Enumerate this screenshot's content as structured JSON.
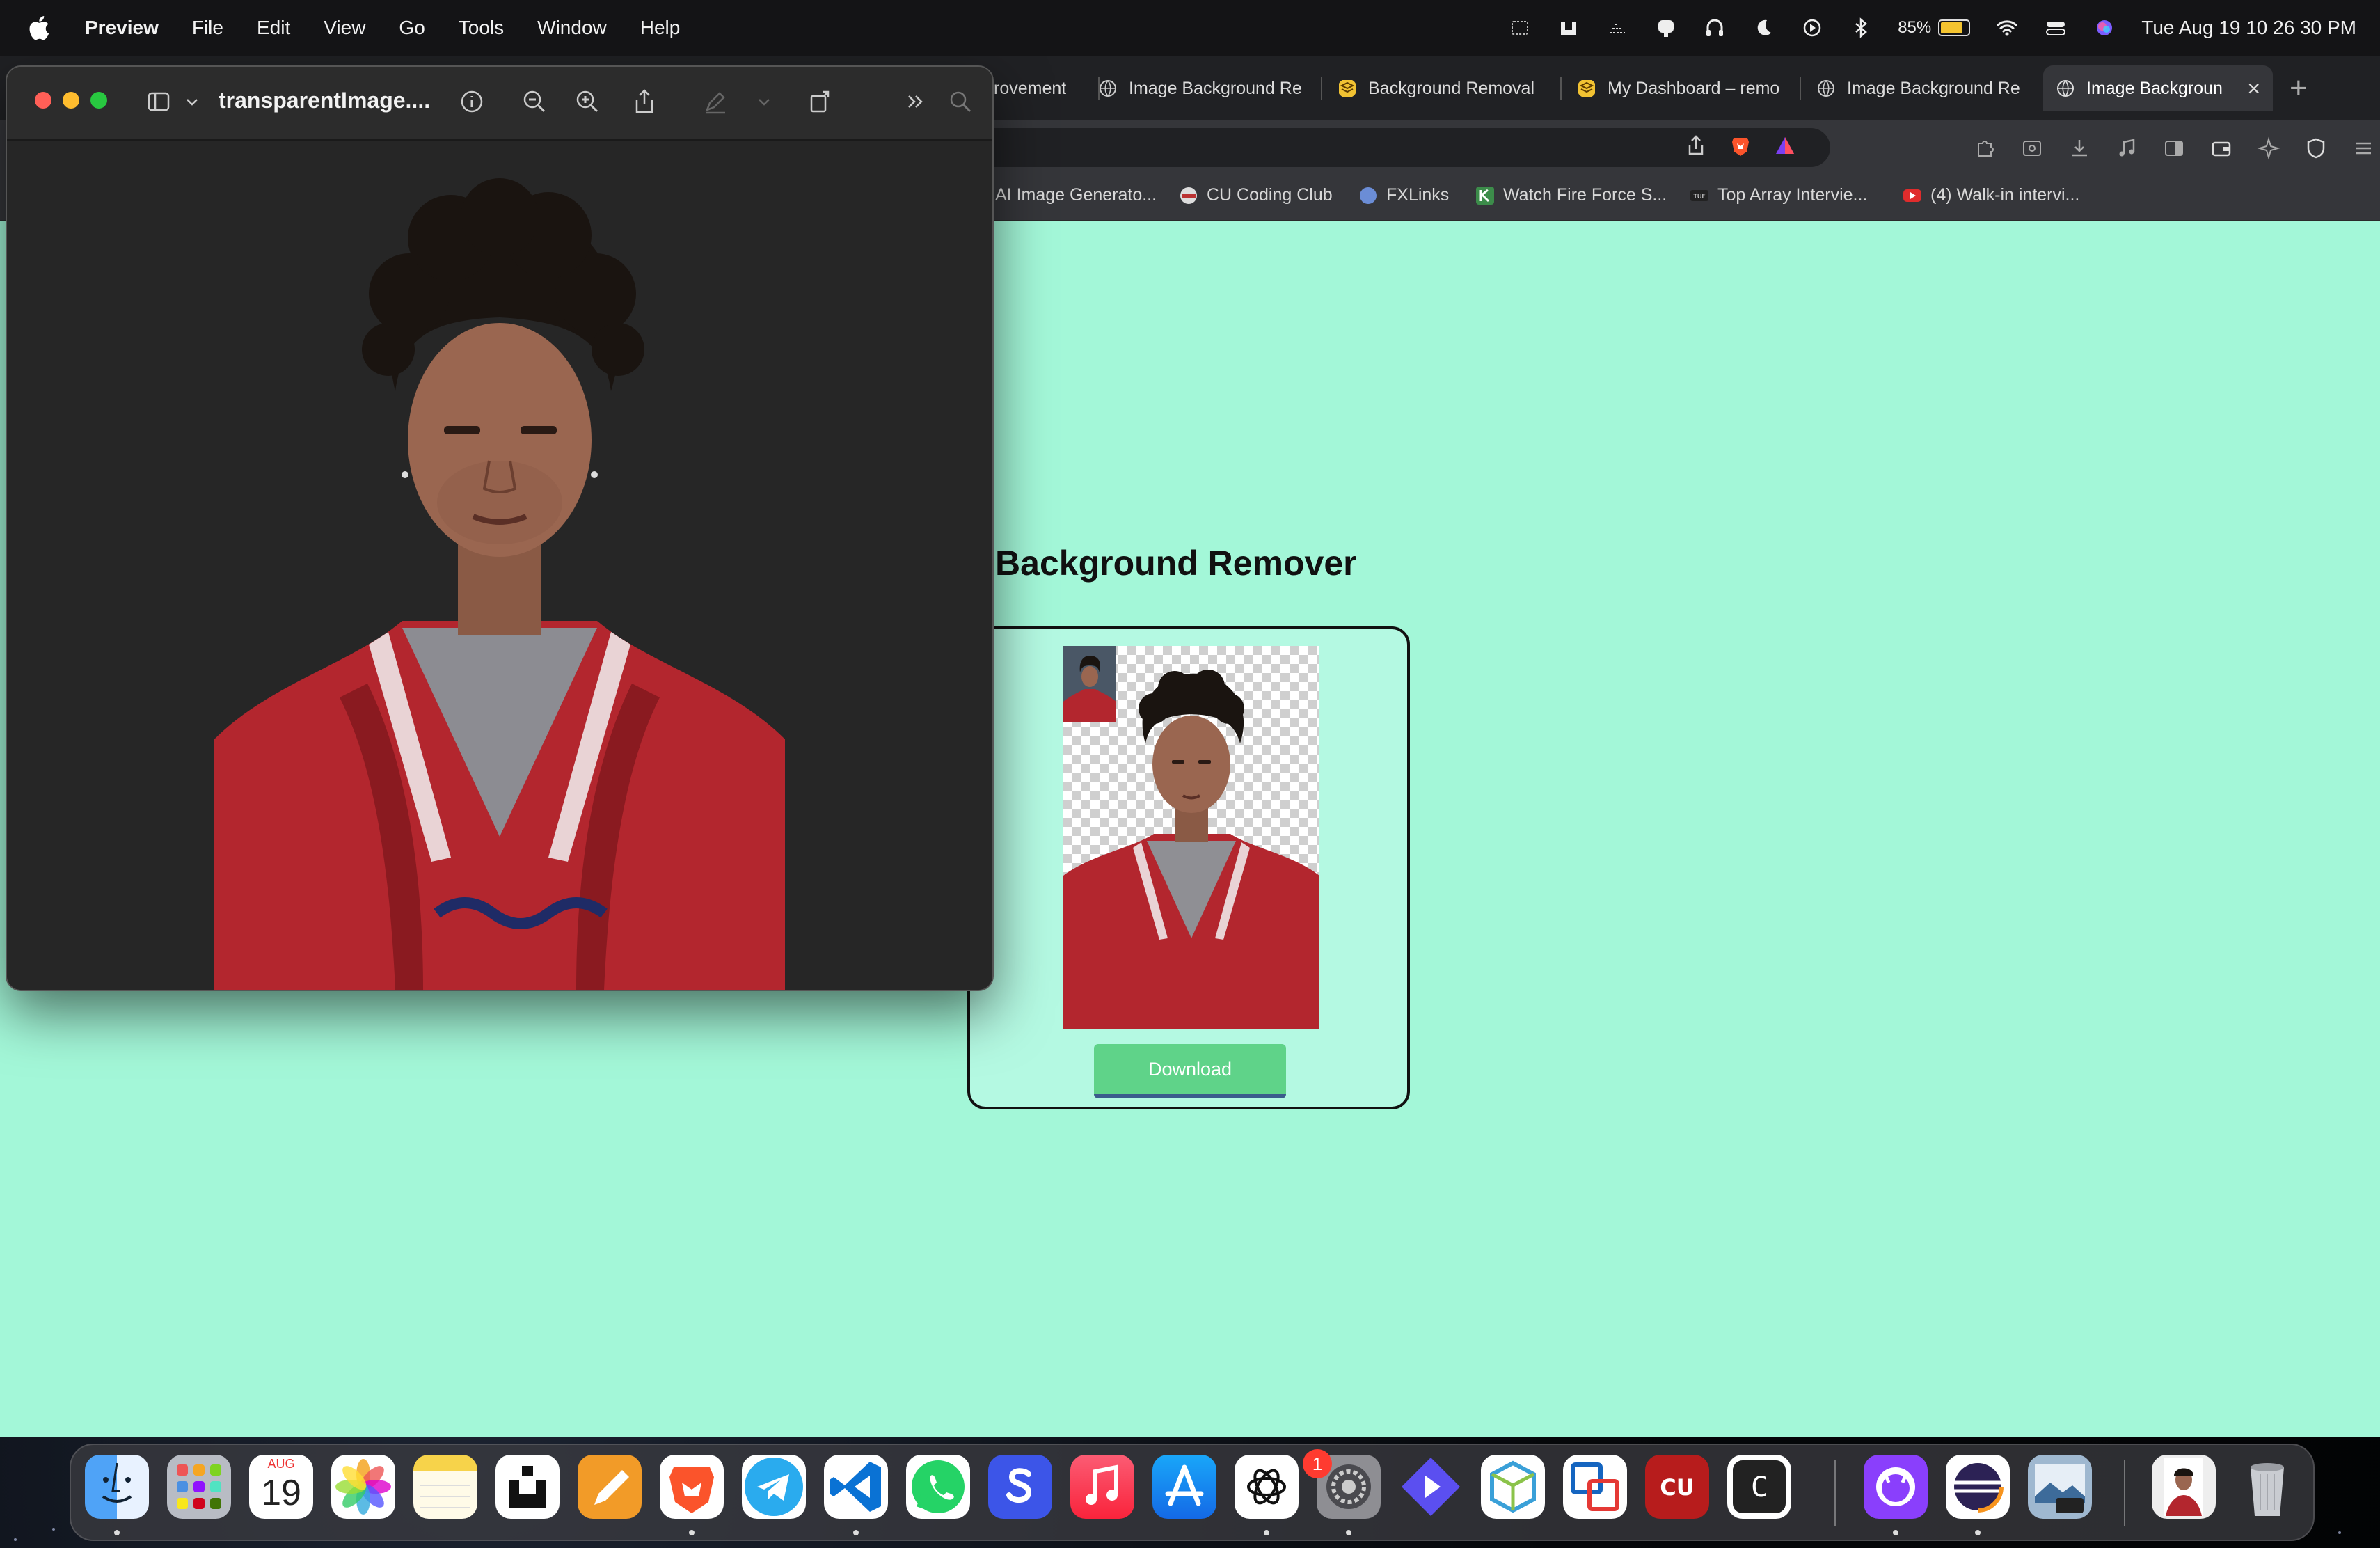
{
  "menubar": {
    "app_name": "Preview",
    "items": [
      "File",
      "Edit",
      "View",
      "Go",
      "Tools",
      "Window",
      "Help"
    ],
    "battery_percent": "85%",
    "battery_level": 0.85,
    "datetime": "Tue Aug 19  10 26 30 PM"
  },
  "browser": {
    "tabs": [
      {
        "label": "rovement",
        "icon": "page-icon"
      },
      {
        "label": "Image Background Re",
        "icon": "globe-icon"
      },
      {
        "label": "Background Removal",
        "icon": "stack-icon"
      },
      {
        "label": "My Dashboard – remo",
        "icon": "stack-icon"
      },
      {
        "label": "Image Background Re",
        "icon": "globe-icon"
      },
      {
        "label": "Image Backgroun",
        "icon": "globe-icon",
        "active": true
      }
    ],
    "bookmarks": [
      {
        "label": "AI Image Generato...",
        "icon": "page-icon"
      },
      {
        "label": "CU Coding Club",
        "icon": "club-icon"
      },
      {
        "label": "FXLinks",
        "icon": "circle-icon"
      },
      {
        "label": "Watch Fire Force S...",
        "icon": "k-icon"
      },
      {
        "label": "Top Array Intervie...",
        "icon": "tuf-icon"
      },
      {
        "label": "(4) Walk-in intervi...",
        "icon": "youtube-icon"
      }
    ],
    "accent_color": "#a3f7d8"
  },
  "page": {
    "title": "age Background Remover",
    "download_label": "Download",
    "button_color": "#5fd389"
  },
  "preview": {
    "title": "transparentImage...."
  },
  "dock": {
    "calendar_month": "AUG",
    "calendar_day": "19",
    "settings_badge": "1",
    "icons": [
      "finder-icon",
      "launchpad-icon",
      "calendar-icon",
      "photos-icon",
      "notes-icon",
      "unstop-icon",
      "pages-icon",
      "brave-icon",
      "telegram-icon",
      "vscode-icon",
      "whatsapp-icon",
      "s-app-icon",
      "music-icon",
      "appstore-icon",
      "chatgpt-icon",
      "settings-icon",
      "linear-icon",
      "cube-icon",
      "vm-icon",
      "cu-icon",
      "c-icon",
      "github-icon",
      "eclipse-icon",
      "preview-doc-icon",
      "photo-doc-icon",
      "trash-icon"
    ]
  }
}
